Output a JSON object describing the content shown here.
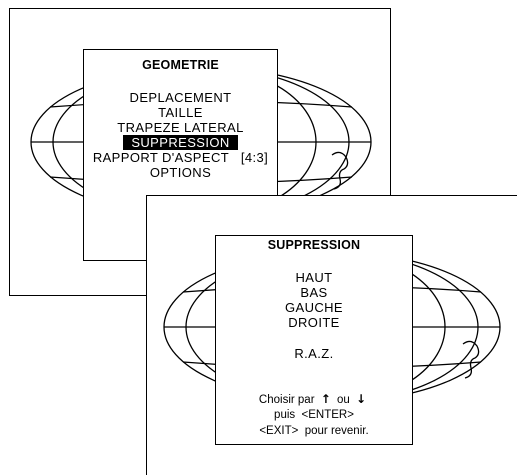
{
  "geometrie_menu": {
    "title": "GEOMETRIE",
    "items": [
      {
        "label": "DEPLACEMENT",
        "selected": false
      },
      {
        "label": "TAILLE",
        "selected": false
      },
      {
        "label": "TRAPEZE LATERAL",
        "selected": false
      },
      {
        "label": "SUPPRESSION",
        "selected": true
      },
      {
        "label": "RAPPORT D'ASPECT   [4:3]",
        "selected": false
      },
      {
        "label": "OPTIONS",
        "selected": false
      }
    ]
  },
  "suppression_menu": {
    "title": "SUPPRESSION",
    "items": [
      {
        "label": "HAUT"
      },
      {
        "label": "BAS"
      },
      {
        "label": "GAUCHE"
      },
      {
        "label": "DROITE"
      },
      {
        "label": "R.A.Z."
      }
    ],
    "hint": {
      "line1_prefix": "Choisir par",
      "line1_or": "ou",
      "arrow_up_icon": "↑",
      "arrow_down_icon": "↓",
      "line2": "puis  <ENTER>",
      "line3": "<EXIT>  pour revenir."
    }
  },
  "colors": {
    "background": "#ffffff",
    "foreground": "#000000",
    "selection_bg": "#000000",
    "selection_fg": "#ffffff"
  }
}
